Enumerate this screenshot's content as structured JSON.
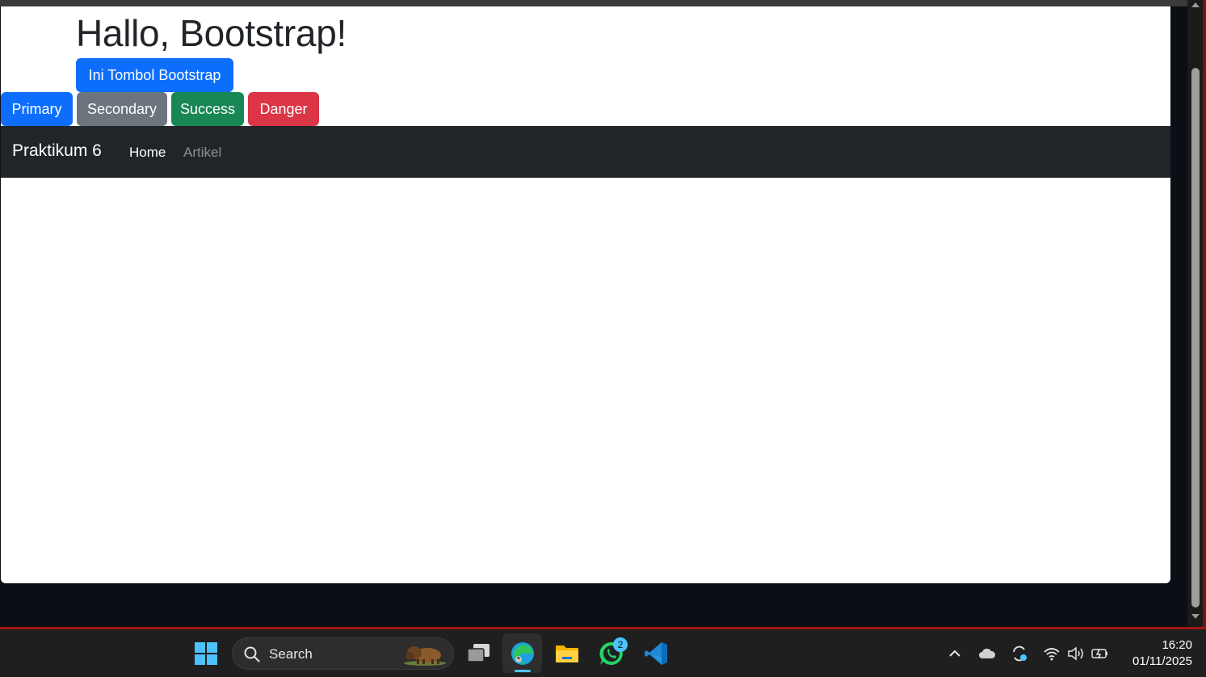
{
  "page": {
    "heading": "Hallo, Bootstrap!",
    "bootstrap_button": "Ini Tombol Bootstrap",
    "buttons": [
      {
        "label": "Primary",
        "color": "#0d6efd"
      },
      {
        "label": "Secondary",
        "color": "#6c757d"
      },
      {
        "label": "Success",
        "color": "#198754"
      },
      {
        "label": "Danger",
        "color": "#dc3545"
      }
    ]
  },
  "navbar": {
    "brand": "Praktikum 6",
    "links": [
      {
        "label": "Home",
        "active": true
      },
      {
        "label": "Artikel",
        "active": false
      }
    ]
  },
  "taskbar": {
    "search_label": "Search",
    "apps": [
      "windows-start-icon",
      "task-view-icon",
      "edge-browser-icon",
      "file-explorer-icon",
      "whatsapp-icon",
      "vscode-icon"
    ],
    "whatsapp_badge": "2",
    "tray": [
      "chevron-up-icon",
      "onedrive-cloud-icon",
      "sync-icon",
      "wifi-icon",
      "volume-icon",
      "battery-icon"
    ],
    "time": "16:20",
    "date": "01/11/2025"
  }
}
